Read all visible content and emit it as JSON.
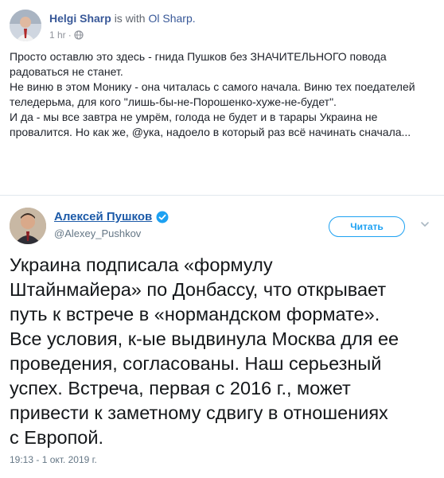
{
  "facebook_post": {
    "author": "Helgi Sharp",
    "is_with_text": "is with",
    "tagged_person": "Ol Sharp.",
    "time": "1 hr",
    "separator": "·",
    "privacy_icon": "globe-icon",
    "paragraphs": [
      "Просто оставлю это здесь - гнида Пушков без ЗНАЧИТЕЛЬНОГО повода радоваться не станет.",
      "Не виню в этом Монику - она читалась с самого начала. Виню тех поедателей теледерьма, для кого \"лишь-бы-не-Порошенко-хуже-не-будет\".",
      "И да - мы все завтра не умрём, голода не будет и в тарары Украина не провалится. Но как же, @ука, надоело в который раз всё начинать сначала..."
    ]
  },
  "tweet": {
    "author_name": "Алексей Пушков",
    "handle": "@Alexey_Pushkov",
    "verified_icon": "verified-badge-icon",
    "follow_label": "Читать",
    "menu_icon": "chevron-down-icon",
    "text_lines": [
      "Украина подписала «формулу",
      "Штайнмайера» по Донбассу, что открывает",
      "путь к встрече в «нормандском формате».",
      "Все условия, к-ые выдвинула Москва для ее",
      "проведения, согласованы. Наш серьезный",
      "успех. Встреча, первая с 2016 г., может",
      "привести к заметному сдвигу в отношениях",
      "с Европой."
    ],
    "timestamp": "19:13 - 1 окт. 2019 г."
  },
  "colors": {
    "fb_link": "#385898",
    "fb_meta": "#90949c",
    "tw_blue": "#1da1f2",
    "tw_name": "#1c5aa8",
    "tw_gray": "#657786"
  }
}
